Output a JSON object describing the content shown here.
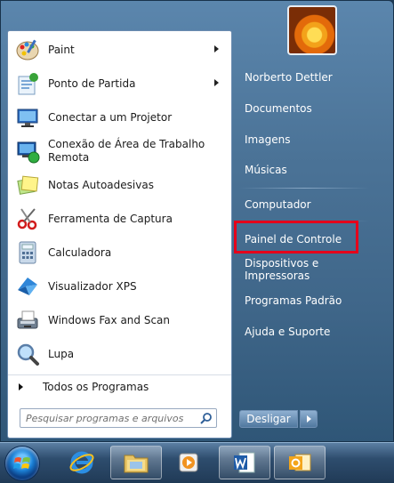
{
  "programs": [
    {
      "label": "Paint",
      "icon": "paint-icon",
      "has_submenu": true
    },
    {
      "label": "Ponto de Partida",
      "icon": "getting-started-icon",
      "has_submenu": true
    },
    {
      "label": "Conectar a um Projetor",
      "icon": "projector-icon",
      "has_submenu": false
    },
    {
      "label": "Conexão de Área de Trabalho\nRemota",
      "icon": "remote-desktop-icon",
      "has_submenu": false
    },
    {
      "label": "Notas Autoadesivas",
      "icon": "sticky-notes-icon",
      "has_submenu": false
    },
    {
      "label": "Ferramenta de Captura",
      "icon": "snipping-tool-icon",
      "has_submenu": false
    },
    {
      "label": "Calculadora",
      "icon": "calculator-icon",
      "has_submenu": false
    },
    {
      "label": "Visualizador XPS",
      "icon": "xps-viewer-icon",
      "has_submenu": false
    },
    {
      "label": "Windows Fax and Scan",
      "icon": "fax-scan-icon",
      "has_submenu": false
    },
    {
      "label": "Lupa",
      "icon": "magnifier-icon",
      "has_submenu": false
    }
  ],
  "all_programs_label": "Todos os Programas",
  "search": {
    "placeholder": "Pesquisar programas e arquivos",
    "icon": "search-icon"
  },
  "user": {
    "picture_icon": "flower-user-picture"
  },
  "right_items": [
    {
      "label": "Norberto Dettler",
      "name": "right-item-user-folder"
    },
    {
      "label": "Documentos",
      "name": "right-item-documents"
    },
    {
      "label": "Imagens",
      "name": "right-item-pictures"
    },
    {
      "label": "Músicas",
      "name": "right-item-music"
    },
    {
      "label": "Computador",
      "name": "right-item-computer"
    },
    {
      "label": "Painel de Controle",
      "name": "right-item-control-panel"
    },
    {
      "label": "Dispositivos e Impressoras",
      "name": "right-item-devices-printers"
    },
    {
      "label": "Programas Padrão",
      "name": "right-item-default-programs"
    },
    {
      "label": "Ajuda e Suporte",
      "name": "right-item-help-support"
    }
  ],
  "highlighted_item": "Painel de Controle",
  "highlight_color": "#e5001b",
  "shutdown_label": "Desligar",
  "taskbar": [
    {
      "name": "start-orb",
      "icon": "windows-logo-icon"
    },
    {
      "name": "taskbar-internet-explorer",
      "icon": "internet-explorer-icon"
    },
    {
      "name": "taskbar-explorer",
      "icon": "folder-icon"
    },
    {
      "name": "taskbar-media-player",
      "icon": "media-player-icon"
    },
    {
      "name": "taskbar-word",
      "icon": "word-icon"
    },
    {
      "name": "taskbar-outlook",
      "icon": "outlook-icon"
    }
  ]
}
